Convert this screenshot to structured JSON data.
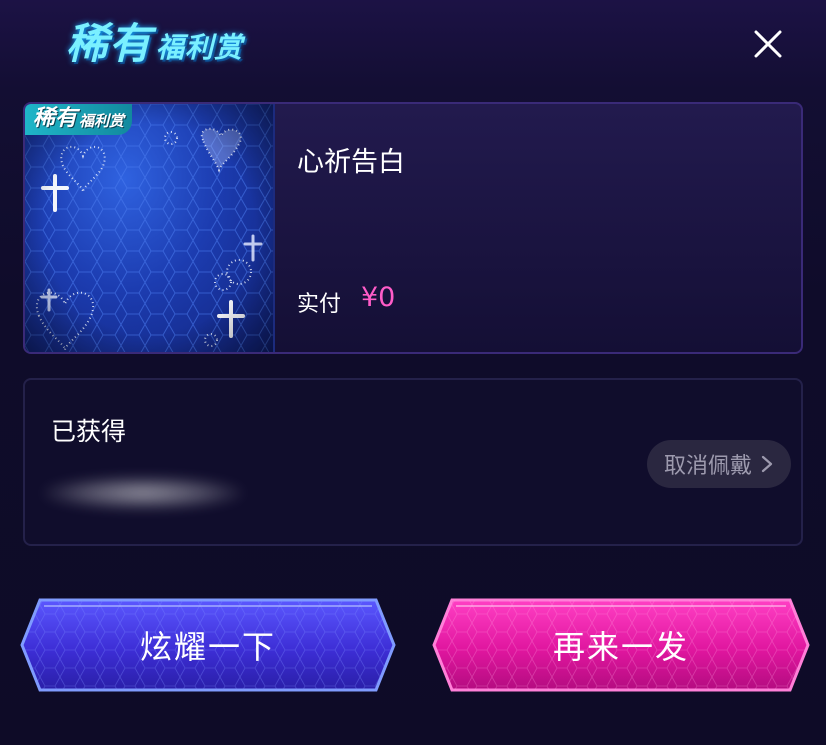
{
  "header": {
    "logo_big": "稀有",
    "logo_small": "福利赏"
  },
  "card": {
    "badge_big": "稀有",
    "badge_small": "福利赏",
    "title": "心祈告白",
    "pay_label": "实付",
    "pay_value": "¥0"
  },
  "obtained": {
    "title": "已获得",
    "unwear_label": "取消佩戴"
  },
  "buttons": {
    "show_off": "炫耀一下",
    "again": "再来一发"
  },
  "colors": {
    "accent_pink": "#ff5cc8",
    "button_blue": "#4a3ce0",
    "button_pink": "#e81aa8"
  }
}
